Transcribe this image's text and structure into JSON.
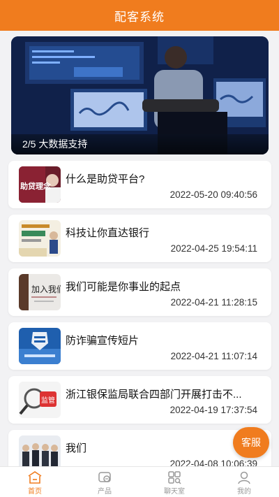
{
  "header": {
    "title": "配客系统"
  },
  "banner": {
    "caption": "2/5 大数据支持"
  },
  "articles": [
    {
      "title": "什么是助贷平台?",
      "date": "2022-05-20 09:40:56",
      "thumb_text": "助贷理念"
    },
    {
      "title": "科技让你直达银行",
      "date": "2022-04-25 19:54:11",
      "thumb_text": ""
    },
    {
      "title": "我们可能是你事业的起点",
      "date": "2022-04-21 11:28:15",
      "thumb_text": "加入我们"
    },
    {
      "title": "防诈骗宣传短片",
      "date": "2022-04-21 11:07:14",
      "thumb_text": ""
    },
    {
      "title": "浙江银保监局联合四部门开展打击不...",
      "date": "2022-04-19 17:37:54",
      "thumb_text": "监管"
    },
    {
      "title": "我们",
      "date": "2022-04-08 10:06:39",
      "thumb_text": ""
    }
  ],
  "service_button": {
    "label": "客服"
  },
  "tabbar": [
    {
      "label": "首页",
      "icon": "home-icon",
      "active": true
    },
    {
      "label": "产品",
      "icon": "product-icon",
      "active": false
    },
    {
      "label": "聊天室",
      "icon": "chatroom-icon",
      "active": false
    },
    {
      "label": "我的",
      "icon": "profile-icon",
      "active": false
    }
  ],
  "colors": {
    "accent": "#f07c1e"
  }
}
